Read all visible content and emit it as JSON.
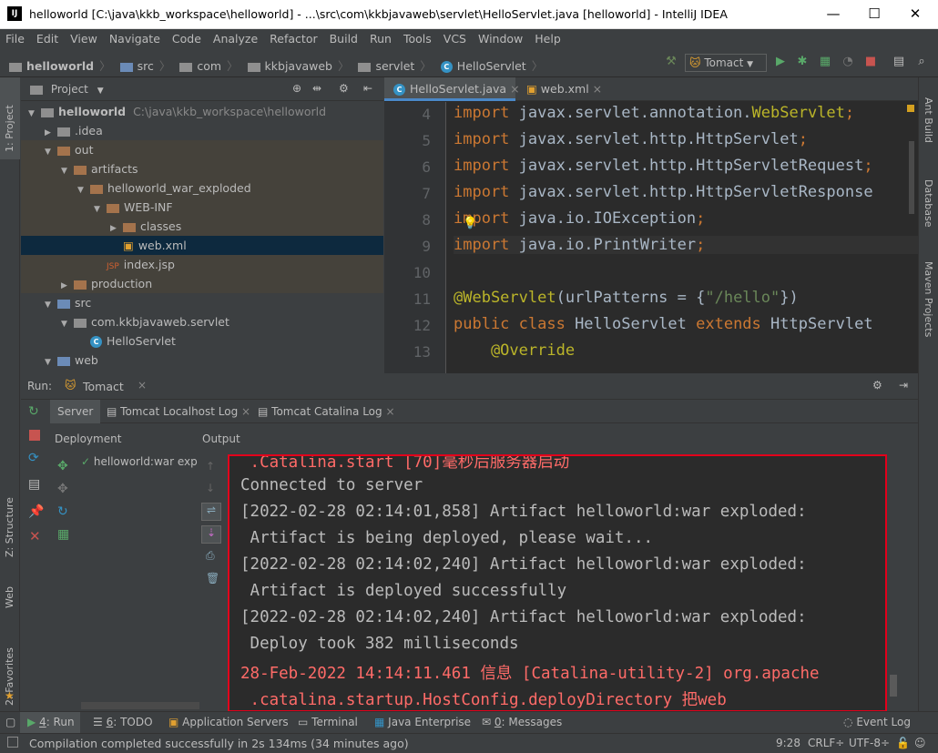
{
  "window": {
    "title": "helloworld [C:\\java\\kkb_workspace\\helloworld] - ...\\src\\com\\kkbjavaweb\\servlet\\HelloServlet.java [helloworld] - IntelliJ IDEA",
    "logo": "IJ",
    "minimize": "—",
    "maximize": "☐",
    "close": "✕"
  },
  "menu": [
    "File",
    "Edit",
    "View",
    "Navigate",
    "Code",
    "Analyze",
    "Refactor",
    "Build",
    "Run",
    "Tools",
    "VCS",
    "Window",
    "Help"
  ],
  "breadcrumb": [
    "helloworld",
    "src",
    "com",
    "kkbjavaweb",
    "servlet",
    "HelloServlet"
  ],
  "run_config": "Tomact",
  "project_panel": {
    "title": "Project",
    "tree": [
      {
        "label": "helloworld",
        "extra": "C:\\java\\kkb_workspace\\helloworld",
        "depth": 0,
        "arrow": "▼",
        "icon": "gray"
      },
      {
        "label": ".idea",
        "depth": 1,
        "arrow": "▶",
        "icon": "gray"
      },
      {
        "label": "out",
        "depth": 1,
        "arrow": "▼",
        "icon": "orange"
      },
      {
        "label": "artifacts",
        "depth": 2,
        "arrow": "▼",
        "icon": "orange"
      },
      {
        "label": "helloworld_war_exploded",
        "depth": 3,
        "arrow": "▼",
        "icon": "orange"
      },
      {
        "label": "WEB-INF",
        "depth": 4,
        "arrow": "▼",
        "icon": "orange"
      },
      {
        "label": "classes",
        "depth": 5,
        "arrow": "▶",
        "icon": "orange"
      },
      {
        "label": "web.xml",
        "depth": 5,
        "arrow": "",
        "icon": "xml"
      },
      {
        "label": "index.jsp",
        "depth": 4,
        "arrow": "",
        "icon": "jsp"
      },
      {
        "label": "production",
        "depth": 2,
        "arrow": "▶",
        "icon": "orange"
      },
      {
        "label": "src",
        "depth": 1,
        "arrow": "▼",
        "icon": "blue"
      },
      {
        "label": "com.kkbjavaweb.servlet",
        "depth": 2,
        "arrow": "▼",
        "icon": "gray"
      },
      {
        "label": "HelloServlet",
        "depth": 3,
        "arrow": "",
        "icon": "class"
      },
      {
        "label": "web",
        "depth": 1,
        "arrow": "▼",
        "icon": "blue"
      }
    ]
  },
  "editor": {
    "tabs": [
      "HelloServlet.java",
      "web.xml"
    ],
    "line_numbers": [
      "4",
      "5",
      "6",
      "7",
      "8",
      "9",
      "10",
      "11",
      "12",
      "13"
    ],
    "lines": [
      [
        [
          "kw",
          "import "
        ],
        [
          "",
          "javax.servlet.annotation."
        ],
        [
          "an",
          "WebServlet"
        ],
        [
          "kw",
          ";"
        ]
      ],
      [
        [
          "kw",
          "import "
        ],
        [
          "",
          "javax.servlet.http.HttpServlet"
        ],
        [
          "kw",
          ";"
        ]
      ],
      [
        [
          "kw",
          "import "
        ],
        [
          "",
          "javax.servlet.http.HttpServletRequest"
        ],
        [
          "kw",
          ";"
        ]
      ],
      [
        [
          "kw",
          "import "
        ],
        [
          "",
          "javax.servlet.http.HttpServletResponse"
        ]
      ],
      [
        [
          "kw",
          "import "
        ],
        [
          "",
          "java.io.IOException"
        ],
        [
          "kw",
          ";"
        ]
      ],
      [
        [
          "kw",
          "import "
        ],
        [
          "",
          "java.io.PrintWriter"
        ],
        [
          "kw",
          ";"
        ]
      ],
      [],
      [
        [
          "an",
          "@WebServlet"
        ],
        [
          "",
          "(urlPatterns = {"
        ],
        [
          "st",
          "\"/hello\""
        ],
        [
          "",
          "})"
        ]
      ],
      [
        [
          "kw",
          "public class "
        ],
        [
          "",
          "HelloServlet "
        ],
        [
          "kw",
          "extends "
        ],
        [
          "",
          "HttpServlet "
        ]
      ],
      [
        [
          "an",
          "    @Override"
        ]
      ]
    ]
  },
  "run_panel": {
    "label": "Run:",
    "config": "Tomact",
    "tabs": [
      "Server",
      "Tomcat Localhost Log",
      "Tomcat Catalina Log"
    ],
    "col_deployment": "Deployment",
    "col_output": "Output",
    "deployment_item": "helloworld:war exp",
    "console": [
      {
        "text": " .Catalina.start [70]毫秒后服务器启动",
        "red": true
      },
      {
        "text": "Connected to server",
        "red": false
      },
      {
        "text": "[2022-02-28 02:14:01,858] Artifact helloworld:war exploded:",
        "red": false
      },
      {
        "text": " Artifact is being deployed, please wait...",
        "red": false
      },
      {
        "text": "[2022-02-28 02:14:02,240] Artifact helloworld:war exploded:",
        "red": false
      },
      {
        "text": " Artifact is deployed successfully",
        "red": false
      },
      {
        "text": "[2022-02-28 02:14:02,240] Artifact helloworld:war exploded:",
        "red": false
      },
      {
        "text": " Deploy took 382 milliseconds",
        "red": false
      },
      {
        "text": "28-Feb-2022 14:14:11.461 信息 [Catalina-utility-2] org.apache",
        "red": true
      },
      {
        "text": " .catalina.startup.HostConfig.deployDirectory 把web",
        "red": true
      }
    ]
  },
  "left_strip": {
    "project": "1: Project",
    "structure": "Z: Structure",
    "web": "Web",
    "favorites": "2: Favorites"
  },
  "right_strip": {
    "ant": "Ant Build",
    "database": "Database",
    "maven": "Maven Projects"
  },
  "bottom_tools": [
    {
      "num": "4",
      "label": ": Run"
    },
    {
      "num": "6",
      "label": ": TODO"
    },
    {
      "num": "",
      "label": "Application Servers"
    },
    {
      "num": "",
      "label": "Terminal"
    },
    {
      "num": "",
      "label": "Java Enterprise"
    },
    {
      "num": "0",
      "label": ": Messages"
    }
  ],
  "event_log": "Event Log",
  "status": {
    "message": "Compilation completed successfully in 2s 134ms (34 minutes ago)",
    "position": "9:28",
    "line_sep": "CRLF÷",
    "encoding": "UTF-8÷"
  }
}
